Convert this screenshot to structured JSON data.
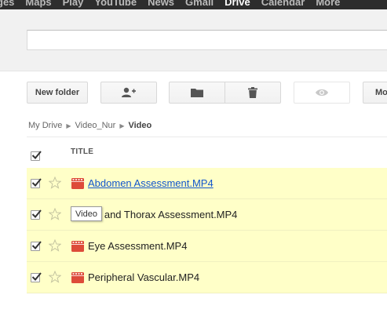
{
  "nav": {
    "items": [
      "ges",
      "Maps",
      "Play",
      "YouTube",
      "News",
      "Gmail",
      "Drive",
      "Calendar",
      "More"
    ],
    "active": "Drive"
  },
  "search": {
    "placeholder": ""
  },
  "toolbar": {
    "new_folder_label": "New folder",
    "more_label": "Mo",
    "icons": [
      "add-person-icon",
      "folder-icon",
      "trash-icon",
      "eye-icon"
    ]
  },
  "breadcrumb": {
    "items": [
      "My Drive",
      "Video_Nur"
    ],
    "current": "Video"
  },
  "list": {
    "column_title": "TITLE",
    "files": [
      {
        "name": "Abdomen Assessment.MP4",
        "checked": true,
        "starred": false,
        "hovered": true
      },
      {
        "name": "g and Thorax Assessment.MP4",
        "checked": true,
        "starred": false,
        "hovered": false
      },
      {
        "name": "Eye Assessment.MP4",
        "checked": true,
        "starred": false,
        "hovered": false
      },
      {
        "name": "Peripheral Vascular.MP4",
        "checked": true,
        "starred": false,
        "hovered": false
      }
    ]
  },
  "tooltip": {
    "text": "Video"
  },
  "colors": {
    "selected_row": "#ffffc8",
    "video_icon": "#dd4b39",
    "link": "#1155cc",
    "topbar": "#2d2d2d"
  }
}
